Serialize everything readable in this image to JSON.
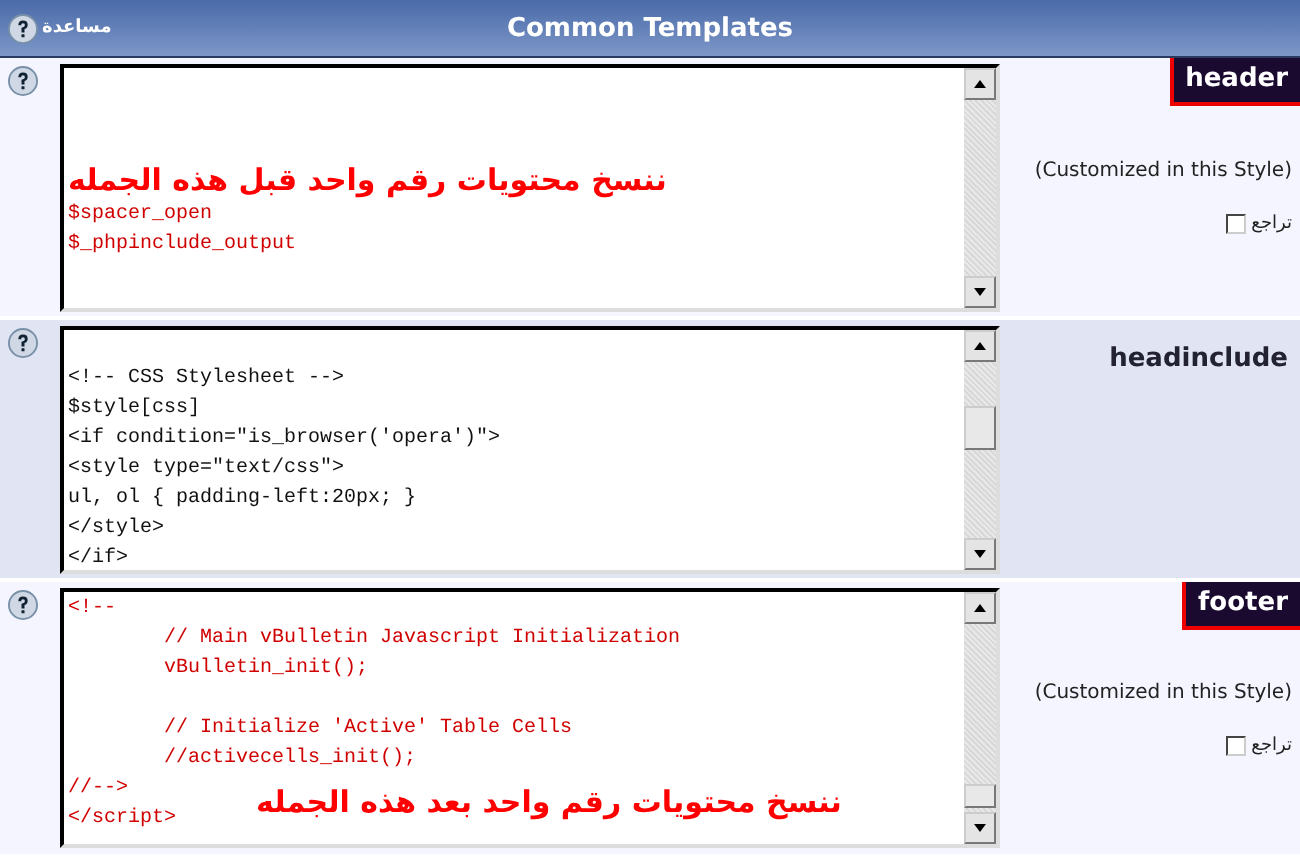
{
  "header_bar": {
    "help_label": "مساعدة",
    "title": "Common Templates"
  },
  "templates": [
    {
      "name": "header",
      "customized": true,
      "status": "(Customized in this Style)",
      "revert": {
        "label": "تراجع",
        "checked": false
      },
      "lines": [
        {
          "kind": "blank"
        },
        {
          "kind": "blank"
        },
        {
          "kind": "blank"
        },
        {
          "kind": "note",
          "text": "ننسخ محتويات رقم واحد قبل هذه الجمله"
        },
        {
          "kind": "code",
          "text": "$spacer_open"
        },
        {
          "kind": "code",
          "text": "$_phpinclude_output"
        }
      ]
    },
    {
      "name": "headinclude",
      "customized": false,
      "lines": [
        {
          "kind": "blank"
        },
        {
          "kind": "code",
          "text": "<!-- CSS Stylesheet -->"
        },
        {
          "kind": "code",
          "text": "$style[css]"
        },
        {
          "kind": "code",
          "text": "<if condition=\"is_browser('opera')\">"
        },
        {
          "kind": "code",
          "text": "<style type=\"text/css\">"
        },
        {
          "kind": "code",
          "text": "ul, ol { padding-left:20px; }"
        },
        {
          "kind": "code",
          "text": "</style>"
        },
        {
          "kind": "code",
          "text": "</if>"
        }
      ]
    },
    {
      "name": "footer",
      "customized": true,
      "status": "(Customized in this Style)",
      "revert": {
        "label": "تراجع",
        "checked": false
      },
      "lines": [
        {
          "kind": "code",
          "text": "<!--"
        },
        {
          "kind": "code",
          "text": "\t// Main vBulletin Javascript Initialization"
        },
        {
          "kind": "code",
          "text": "\tvBulletin_init();"
        },
        {
          "kind": "blank"
        },
        {
          "kind": "code",
          "text": "\t// Initialize 'Active' Table Cells"
        },
        {
          "kind": "code",
          "text": "\t//activecells_init();"
        },
        {
          "kind": "code",
          "text": "//-->"
        },
        {
          "kind": "code",
          "text": "</script>",
          "note": "ننسخ محتويات رقم واحد بعد هذه الجمله"
        }
      ]
    }
  ]
}
